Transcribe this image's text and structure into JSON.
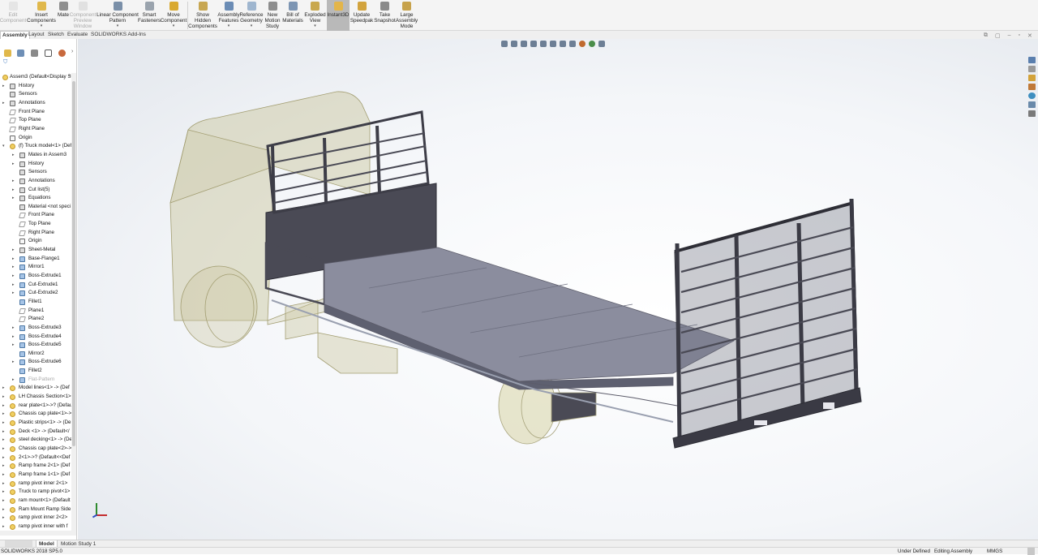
{
  "ribbon": {
    "buttons": [
      {
        "label": "Edit Component",
        "icon": "edit-component-icon",
        "disabled": true
      },
      {
        "label": "Insert Components",
        "icon": "insert-components-icon"
      },
      {
        "label": "Mate",
        "icon": "mate-icon"
      },
      {
        "label": "Component Preview Window",
        "icon": "component-preview-icon",
        "disabled": true
      },
      {
        "label": "Linear Component Pattern",
        "icon": "linear-pattern-icon"
      },
      {
        "label": "Smart Fasteners",
        "icon": "smart-fasteners-icon"
      },
      {
        "label": "Move Component",
        "icon": "move-component-icon"
      },
      {
        "label": "Show Hidden Components",
        "icon": "show-hidden-icon"
      },
      {
        "label": "Assembly Features",
        "icon": "assembly-features-icon"
      },
      {
        "label": "Reference Geometry",
        "icon": "reference-geometry-icon"
      },
      {
        "label": "New Motion Study",
        "icon": "motion-study-icon"
      },
      {
        "label": "Bill of Materials",
        "icon": "bom-icon"
      },
      {
        "label": "Exploded View",
        "icon": "exploded-view-icon"
      },
      {
        "label": "Instant3D",
        "icon": "instant3d-icon",
        "active": true
      },
      {
        "label": "Update Speedpak",
        "icon": "speedpak-icon"
      },
      {
        "label": "Take Snapshot",
        "icon": "snapshot-icon"
      },
      {
        "label": "Large Assembly Mode",
        "icon": "large-assembly-icon"
      }
    ]
  },
  "command_tabs": [
    "Assembly",
    "Layout",
    "Sketch",
    "Evaluate",
    "SOLIDWORKS Add-Ins"
  ],
  "active_tab": "Assembly",
  "tree": {
    "root": "Assem3  (Default<Display St",
    "items": [
      {
        "label": "History",
        "indent": 1,
        "icon": "history-icon",
        "kind": "folder",
        "expand": true
      },
      {
        "label": "Sensors",
        "indent": 1,
        "icon": "sensors-icon",
        "kind": "folder"
      },
      {
        "label": "Annotations",
        "indent": 1,
        "icon": "annotations-icon",
        "kind": "folder",
        "expand": true
      },
      {
        "label": "Front Plane",
        "indent": 1,
        "icon": "plane-icon",
        "kind": "plane"
      },
      {
        "label": "Top Plane",
        "indent": 1,
        "icon": "plane-icon",
        "kind": "plane"
      },
      {
        "label": "Right Plane",
        "indent": 1,
        "icon": "plane-icon",
        "kind": "plane"
      },
      {
        "label": "Origin",
        "indent": 1,
        "icon": "origin-icon",
        "kind": "origin"
      },
      {
        "label": "(f) Truck model<1> (Def",
        "indent": 1,
        "icon": "part-icon",
        "kind": "part",
        "expand": "open"
      },
      {
        "label": "Mates in Assem3",
        "indent": 2,
        "icon": "mates-icon",
        "kind": "folder",
        "expand": true
      },
      {
        "label": "History",
        "indent": 2,
        "icon": "history-icon",
        "kind": "folder",
        "expand": true
      },
      {
        "label": "Sensors",
        "indent": 2,
        "icon": "sensors-icon",
        "kind": "folder"
      },
      {
        "label": "Annotations",
        "indent": 2,
        "icon": "annotations-icon",
        "kind": "folder",
        "expand": true
      },
      {
        "label": "Cut list(5)",
        "indent": 2,
        "icon": "cutlist-icon",
        "kind": "folder",
        "expand": true
      },
      {
        "label": "Equations",
        "indent": 2,
        "icon": "equations-icon",
        "kind": "folder",
        "expand": true
      },
      {
        "label": "Material <not speci",
        "indent": 2,
        "icon": "material-icon",
        "kind": "folder"
      },
      {
        "label": "Front Plane",
        "indent": 2,
        "icon": "plane-icon",
        "kind": "plane"
      },
      {
        "label": "Top Plane",
        "indent": 2,
        "icon": "plane-icon",
        "kind": "plane"
      },
      {
        "label": "Right Plane",
        "indent": 2,
        "icon": "plane-icon",
        "kind": "plane"
      },
      {
        "label": "Origin",
        "indent": 2,
        "icon": "origin-icon",
        "kind": "origin"
      },
      {
        "label": "Sheet-Metal",
        "indent": 2,
        "icon": "sheet-metal-icon",
        "kind": "folder",
        "expand": true
      },
      {
        "label": "Base-Flange1",
        "indent": 2,
        "icon": "feature-icon",
        "kind": "feat",
        "expand": true
      },
      {
        "label": "Mirror1",
        "indent": 2,
        "icon": "mirror-icon",
        "kind": "feat",
        "expand": true
      },
      {
        "label": "Boss-Extrude1",
        "indent": 2,
        "icon": "extrude-icon",
        "kind": "feat",
        "expand": true
      },
      {
        "label": "Cut-Extrude1",
        "indent": 2,
        "icon": "cut-extrude-icon",
        "kind": "feat",
        "expand": true
      },
      {
        "label": "Cut-Extrude2",
        "indent": 2,
        "icon": "cut-extrude-icon",
        "kind": "feat",
        "expand": true
      },
      {
        "label": "Fillet1",
        "indent": 2,
        "icon": "fillet-icon",
        "kind": "feat"
      },
      {
        "label": "Plane1",
        "indent": 2,
        "icon": "plane-icon",
        "kind": "plane"
      },
      {
        "label": "Plane2",
        "indent": 2,
        "icon": "plane-icon",
        "kind": "plane"
      },
      {
        "label": "Boss-Extrude3",
        "indent": 2,
        "icon": "extrude-icon",
        "kind": "feat",
        "expand": true
      },
      {
        "label": "Boss-Extrude4",
        "indent": 2,
        "icon": "extrude-icon",
        "kind": "feat",
        "expand": true
      },
      {
        "label": "Boss-Extrude5",
        "indent": 2,
        "icon": "extrude-icon",
        "kind": "feat",
        "expand": true
      },
      {
        "label": "Mirror2",
        "indent": 2,
        "icon": "mirror-icon",
        "kind": "feat"
      },
      {
        "label": "Boss-Extrude6",
        "indent": 2,
        "icon": "extrude-icon",
        "kind": "feat",
        "expand": true
      },
      {
        "label": "Fillet2",
        "indent": 2,
        "icon": "fillet-icon",
        "kind": "feat"
      },
      {
        "label": "Flat-Pattern",
        "indent": 2,
        "icon": "flat-pattern-icon",
        "kind": "feat",
        "expand": true,
        "suppressed": true
      },
      {
        "label": "Model lines<1> -> (Def",
        "indent": 1,
        "icon": "part-icon",
        "kind": "part",
        "expand": true
      },
      {
        "label": "LH Chassis Section<1>",
        "indent": 1,
        "icon": "part-icon",
        "kind": "part",
        "expand": true
      },
      {
        "label": "rear plate<1>->? (Defau",
        "indent": 1,
        "icon": "part-icon",
        "kind": "part",
        "expand": true
      },
      {
        "label": "Chassis cap plate<1>->",
        "indent": 1,
        "icon": "part-icon",
        "kind": "part",
        "expand": true
      },
      {
        "label": "Plastic strips<1> -> (De",
        "indent": 1,
        "icon": "part-icon",
        "kind": "part",
        "expand": true
      },
      {
        "label": "Deck <1> -> (Default</",
        "indent": 1,
        "icon": "part-icon",
        "kind": "part",
        "expand": true
      },
      {
        "label": "steel decking<1> -> (De",
        "indent": 1,
        "icon": "part-icon",
        "kind": "part",
        "expand": true
      },
      {
        "label": "Chassis cap plate<2>->",
        "indent": 1,
        "icon": "part-icon",
        "kind": "part",
        "expand": true
      },
      {
        "label": "2<1>->? (Default<<Def",
        "indent": 1,
        "icon": "part-icon",
        "kind": "part",
        "expand": true
      },
      {
        "label": "Ramp frame 2<1> (Def",
        "indent": 1,
        "icon": "part-icon",
        "kind": "part",
        "expand": true
      },
      {
        "label": "Ramp frame 1<1> (Def",
        "indent": 1,
        "icon": "part-icon",
        "kind": "part",
        "expand": true
      },
      {
        "label": "ramp pivot inner 2<1>",
        "indent": 1,
        "icon": "part-icon",
        "kind": "part",
        "expand": true
      },
      {
        "label": "Truck to ramp pivot<1>",
        "indent": 1,
        "icon": "part-icon",
        "kind": "part",
        "expand": true
      },
      {
        "label": "ram mount<1> (Default",
        "indent": 1,
        "icon": "part-icon",
        "kind": "part",
        "expand": true
      },
      {
        "label": "Ram Mount Ramp Side",
        "indent": 1,
        "icon": "part-icon",
        "kind": "part",
        "expand": true
      },
      {
        "label": "ramp pivot inner 2<2>",
        "indent": 1,
        "icon": "part-icon",
        "kind": "part",
        "expand": true
      },
      {
        "label": "ramp pivot inner with f",
        "indent": 1,
        "icon": "part-icon",
        "kind": "part",
        "expand": true
      }
    ]
  },
  "bottom_tabs": [
    "Model",
    "Motion Study 1"
  ],
  "active_bottom_tab": "Model",
  "status": {
    "app": "SOLIDWORKS 2018 SP5.0",
    "definition": "Under Defined",
    "mode": "Editing Assembly",
    "units": "MMGS"
  }
}
